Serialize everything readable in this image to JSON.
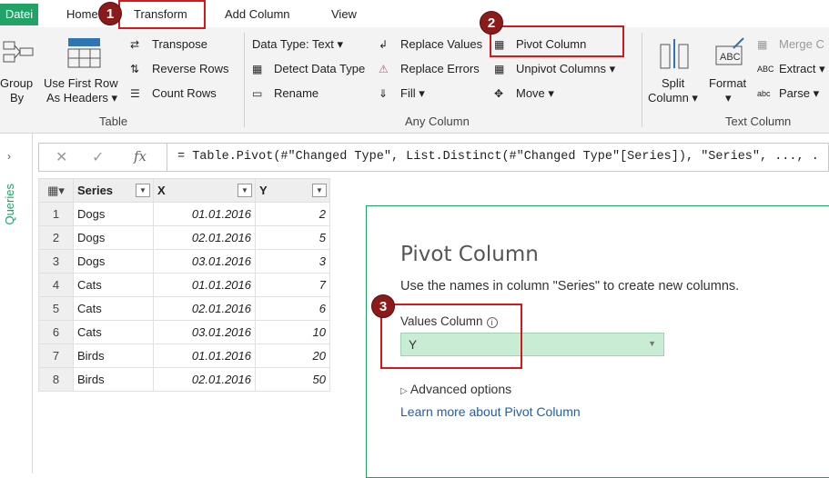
{
  "tabs": {
    "file": "Datei",
    "home": "Home",
    "transform": "Transform",
    "add_column": "Add Column",
    "view": "View"
  },
  "ribbon": {
    "table_group": {
      "group_by": [
        "Group",
        "By"
      ],
      "use_first_row": [
        "Use First Row",
        "As Headers ▾"
      ],
      "transpose": "Transpose",
      "reverse_rows": "Reverse Rows",
      "count_rows": "Count Rows",
      "label": "Table"
    },
    "any_column_group": {
      "data_type": "Data Type: Text ▾",
      "detect_type": "Detect Data Type",
      "rename": "Rename",
      "replace_values": "Replace Values",
      "replace_errors": "Replace Errors",
      "fill": "Fill ▾",
      "pivot_column": "Pivot Column",
      "unpivot_columns": "Unpivot Columns ▾",
      "move": "Move ▾",
      "label": "Any Column"
    },
    "text_column_group": {
      "split_column": [
        "Split",
        "Column ▾"
      ],
      "format": [
        "Format",
        "▾"
      ],
      "merge": "Merge C",
      "extract": "Extract ▾",
      "parse": "Parse ▾",
      "label": "Text Column"
    }
  },
  "queries_pane": {
    "label": "Queries",
    "expand_icon": "›"
  },
  "formula_bar": {
    "cancel_icon": "✕",
    "confirm_icon": "✓",
    "fx_icon": "fx",
    "formula": "= Table.Pivot(#\"Changed Type\", List.Distinct(#\"Changed Type\"[Series]), \"Series\", ..., ."
  },
  "table": {
    "columns": [
      "Series",
      "X",
      "Y"
    ],
    "rows": [
      [
        "1",
        "Dogs",
        "01.01.2016",
        "2"
      ],
      [
        "2",
        "Dogs",
        "02.01.2016",
        "5"
      ],
      [
        "3",
        "Dogs",
        "03.01.2016",
        "3"
      ],
      [
        "4",
        "Cats",
        "01.01.2016",
        "7"
      ],
      [
        "5",
        "Cats",
        "02.01.2016",
        "6"
      ],
      [
        "6",
        "Cats",
        "03.01.2016",
        "10"
      ],
      [
        "7",
        "Birds",
        "01.01.2016",
        "20"
      ],
      [
        "8",
        "Birds",
        "02.01.2016",
        "50"
      ]
    ]
  },
  "dialog": {
    "title": "Pivot Column",
    "description": "Use the names in column \"Series\" to create new columns.",
    "values_column_label": "Values Column",
    "values_column_value": "Y",
    "advanced_options": "Advanced options",
    "learn_more": "Learn more about Pivot Column"
  },
  "callouts": [
    "1",
    "2",
    "3"
  ],
  "colors": {
    "accent": "#21a366",
    "callout": "#d21a1a",
    "badge": "#8b1a1a",
    "link": "#1a5fb4"
  }
}
